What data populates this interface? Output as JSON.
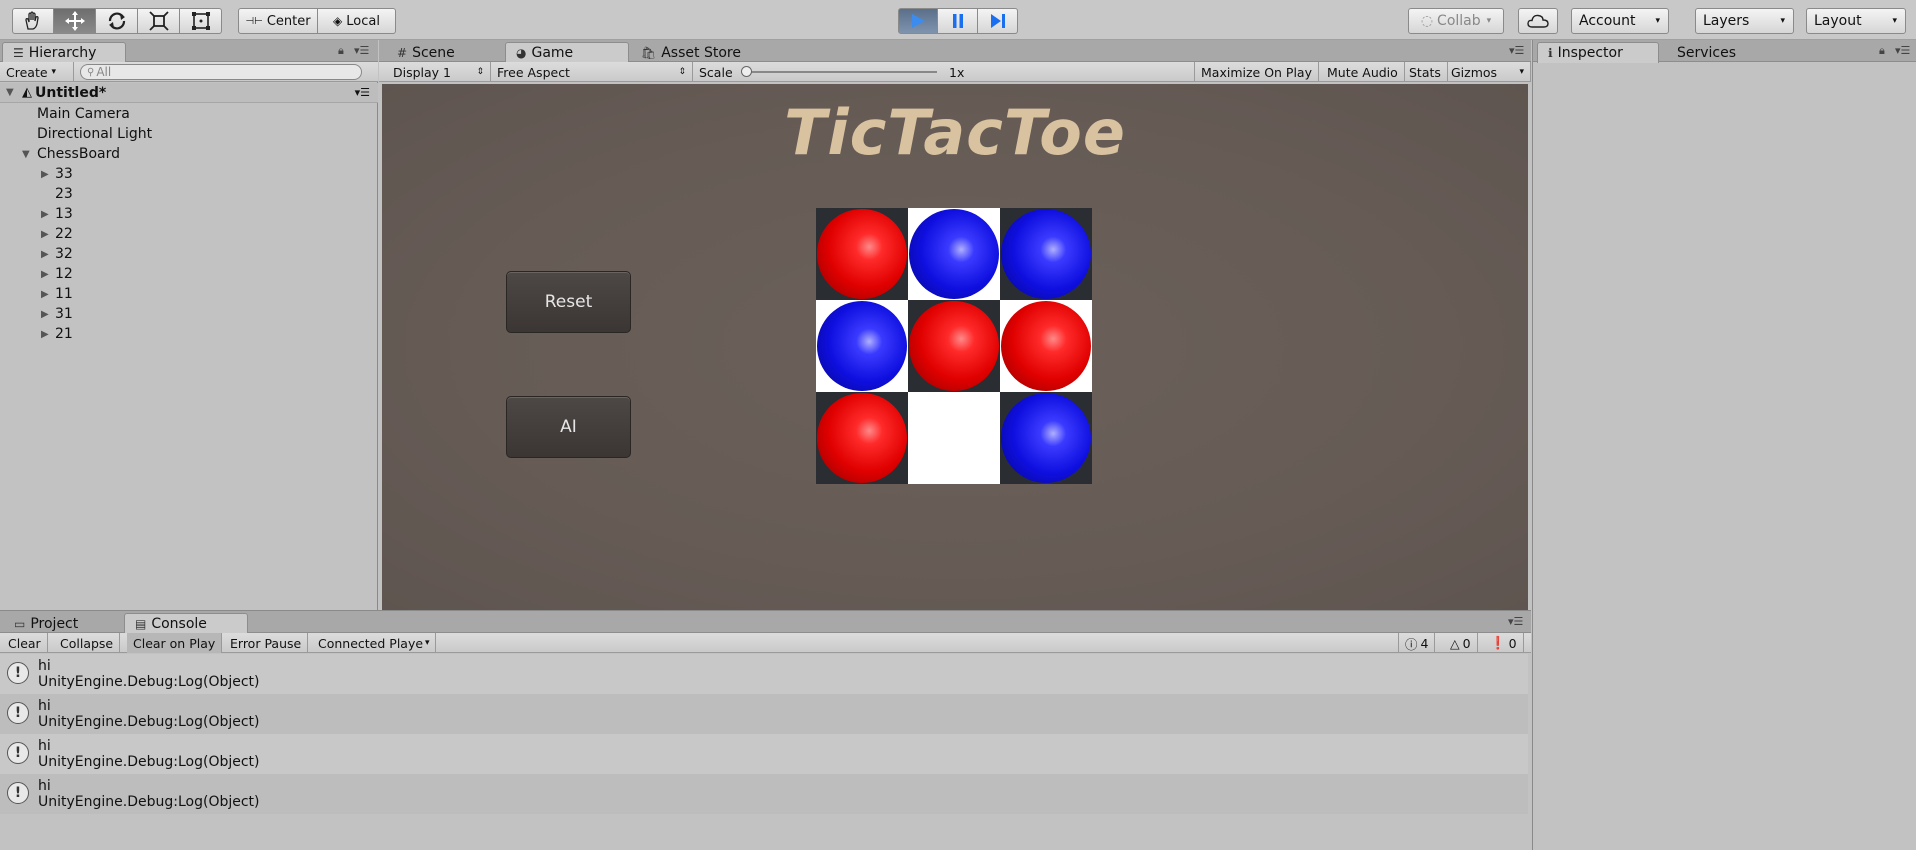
{
  "toolbar": {
    "pivot_label": "Center",
    "space_label": "Local",
    "collab_label": "Collab",
    "account_label": "Account",
    "layers_label": "Layers",
    "layout_label": "Layout"
  },
  "hierarchy": {
    "tab_label": "Hierarchy",
    "create_label": "Create",
    "search_placeholder": "All",
    "scene_name": "Untitled*",
    "items": [
      {
        "label": "Main Camera"
      },
      {
        "label": "Directional Light"
      },
      {
        "label": "ChessBoard"
      }
    ],
    "children": [
      {
        "label": "33",
        "expandable": true
      },
      {
        "label": "23",
        "expandable": false
      },
      {
        "label": "13",
        "expandable": true
      },
      {
        "label": "22",
        "expandable": true
      },
      {
        "label": "32",
        "expandable": true
      },
      {
        "label": "12",
        "expandable": true
      },
      {
        "label": "11",
        "expandable": true
      },
      {
        "label": "31",
        "expandable": true
      },
      {
        "label": "21",
        "expandable": true
      }
    ]
  },
  "center_tabs": {
    "scene": "Scene",
    "game": "Game",
    "asset_store": "Asset Store"
  },
  "game_bar": {
    "display": "Display 1",
    "aspect": "Free Aspect",
    "scale_label": "Scale",
    "scale_value": "1x",
    "maximize": "Maximize On Play",
    "mute": "Mute Audio",
    "stats": "Stats",
    "gizmos": "Gizmos"
  },
  "game": {
    "title": "TicTacToe",
    "reset_label": "Reset",
    "ai_label": "AI",
    "board": [
      [
        "red",
        "blue",
        "blue"
      ],
      [
        "blue",
        "red",
        "red"
      ],
      [
        "red",
        "empty",
        "blue"
      ]
    ]
  },
  "right_tabs": {
    "inspector": "Inspector",
    "services": "Services"
  },
  "bottom_tabs": {
    "project": "Project",
    "console": "Console"
  },
  "console_bar": {
    "clear": "Clear",
    "collapse": "Collapse",
    "clear_on_play": "Clear on Play",
    "error_pause": "Error Pause",
    "connected_player": "Connected Playe",
    "warn_count": "4",
    "notice_count": "0",
    "error_count": "0"
  },
  "console_logs": [
    {
      "message": "hi",
      "trace": "UnityEngine.Debug:Log(Object)"
    },
    {
      "message": "hi",
      "trace": "UnityEngine.Debug:Log(Object)"
    },
    {
      "message": "hi",
      "trace": "UnityEngine.Debug:Log(Object)"
    },
    {
      "message": "hi",
      "trace": "UnityEngine.Debug:Log(Object)"
    }
  ],
  "colors": {
    "play_active": "#3c8cf0",
    "red_piece": "#e00000",
    "blue_piece": "#0f0fe0",
    "title_color": "#d9c2a0"
  }
}
